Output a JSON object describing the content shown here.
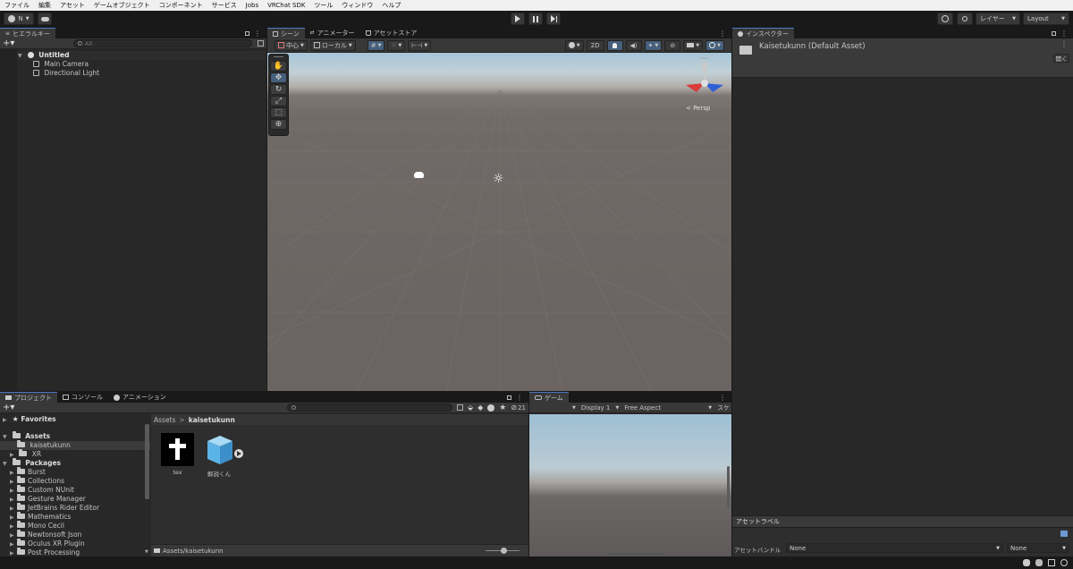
{
  "menubar": {
    "items": [
      "ファイル",
      "編集",
      "アセット",
      "ゲームオブジェクト",
      "コンポーネント",
      "サービス",
      "Jobs",
      "VRChat SDK",
      "ツール",
      "ウィンドウ",
      "ヘルプ"
    ]
  },
  "toolbar": {
    "account_label": "N",
    "layers_label": "レイヤー",
    "layout_label": "Layout"
  },
  "hierarchy": {
    "tab_label": "ヒエラルキー",
    "search_placeholder": "All",
    "scene_name": "Untitled",
    "items": [
      "Main Camera",
      "Directional Light"
    ]
  },
  "scene_panel": {
    "tabs": [
      "シーン",
      "アニメーター",
      "アセットストア"
    ],
    "pivot_label": "中心",
    "space_label": "ローカル",
    "mode_2d": "2D",
    "persp_label": "< Persp"
  },
  "inspector": {
    "tab_label": "インスペクター",
    "asset_title": "Kaisetukunn (Default Asset)",
    "open_button": "開く",
    "asset_labels_title": "アセットラベル",
    "asset_bundle_label": "アセットバンドル",
    "bundle_value": "None",
    "variant_value": "None"
  },
  "project": {
    "tabs": [
      "プロジェクト",
      "コンソール",
      "アニメーション"
    ],
    "hidden_count": "21",
    "breadcrumb_root": "Assets",
    "breadcrumb_current": "kaisetukunn",
    "favorites": "Favorites",
    "assets_root": "Assets",
    "assets_children": [
      "kaisetukunn",
      "XR"
    ],
    "packages_root": "Packages",
    "packages": [
      "Burst",
      "Collections",
      "Custom NUnit",
      "Gesture Manager",
      "JetBrains Rider Editor",
      "Mathematics",
      "Mono Cecil",
      "Newtonsoft Json",
      "Oculus XR Plugin",
      "Post Processing"
    ],
    "grid_items": [
      "tex",
      "解説くん"
    ],
    "footer_path": "Assets/kaisetukunn"
  },
  "game_panel": {
    "tab_label": "ゲーム",
    "display_label": "Display 1",
    "aspect_label": "Free Aspect",
    "scale_label": "スケ"
  },
  "colors": {
    "accent": "#4a78c8",
    "panel": "#282828",
    "toolbar": "#191919"
  }
}
